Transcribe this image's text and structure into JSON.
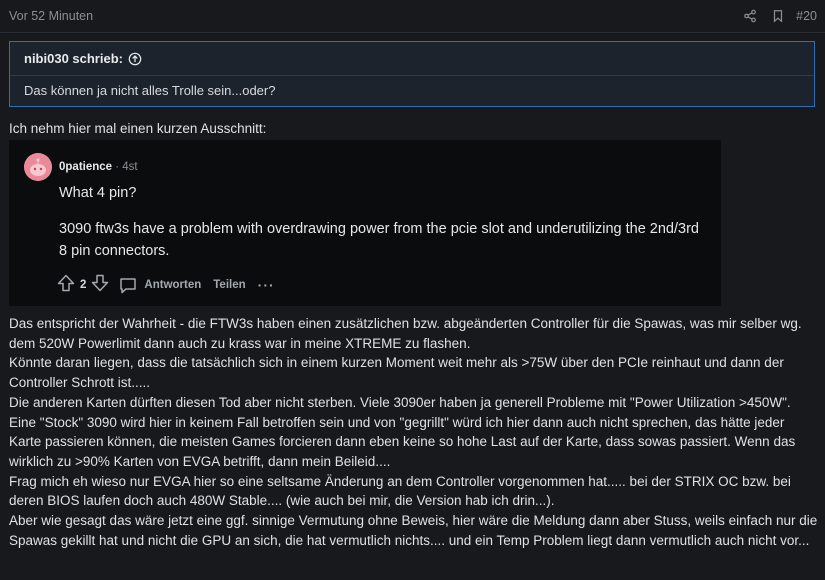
{
  "post": {
    "time": "Vor 52 Minuten",
    "number": "#20",
    "icons": [
      "share-icon",
      "bookmark-icon"
    ]
  },
  "quote": {
    "author": "nibi030 schrieb:",
    "text": "Das können ja nicht alles Trolle sein...oder?"
  },
  "intro": "Ich nehm hier mal einen kurzen Ausschnitt:",
  "embed": {
    "username": "0patience",
    "age": "· 4st",
    "question": "What 4 pin?",
    "body": "3090 ftw3s have a problem with overdrawing power from the pcie slot and underutilizing the 2nd/3rd 8 pin connectors.",
    "votes": "2",
    "reply_label": "Antworten",
    "share_label": "Teilen",
    "more_label": "···"
  },
  "body": {
    "lines": [
      "Das entspricht der Wahrheit - die FTW3s haben einen zusätzlichen bzw. abgeänderten Controller für die Spawas, was mir selber wg. dem 520W Powerlimit dann auch zu krass war in meine XTREME zu flashen.",
      "Könnte daran liegen, dass die tatsächlich sich in einem kurzen Moment weit mehr als >75W über den PCIe reinhaut und dann der Controller Schrott ist.....",
      "Die anderen Karten dürften diesen Tod aber nicht sterben. Viele 3090er haben ja generell Probleme mit \"Power Utilization >450W\". Eine \"Stock\" 3090 wird hier in keinem Fall betroffen sein und von \"gegrillt\" würd ich hier dann auch nicht sprechen, das hätte jeder Karte passieren können, die meisten Games forcieren dann eben keine so hohe Last auf der Karte, dass sowas passiert. Wenn das wirklich zu >90% Karten von EVGA betrifft, dann mein Beileid....",
      "Frag mich eh wieso nur EVGA hier so eine seltsame Änderung an dem Controller vorgenommen hat..... bei der STRIX OC bzw. bei deren BIOS laufen doch auch 480W Stable.... (wie auch bei mir, die Version hab ich drin...).",
      "Aber wie gesagt das wäre jetzt eine ggf. sinnige Vermutung ohne Beweis, hier wäre die Meldung dann aber Stuss, weils einfach nur die Spawas gekillt hat und nicht die GPU an sich, die hat vermutlich nichts.... und ein Temp Problem liegt dann vermutlich auch nicht vor..."
    ]
  }
}
